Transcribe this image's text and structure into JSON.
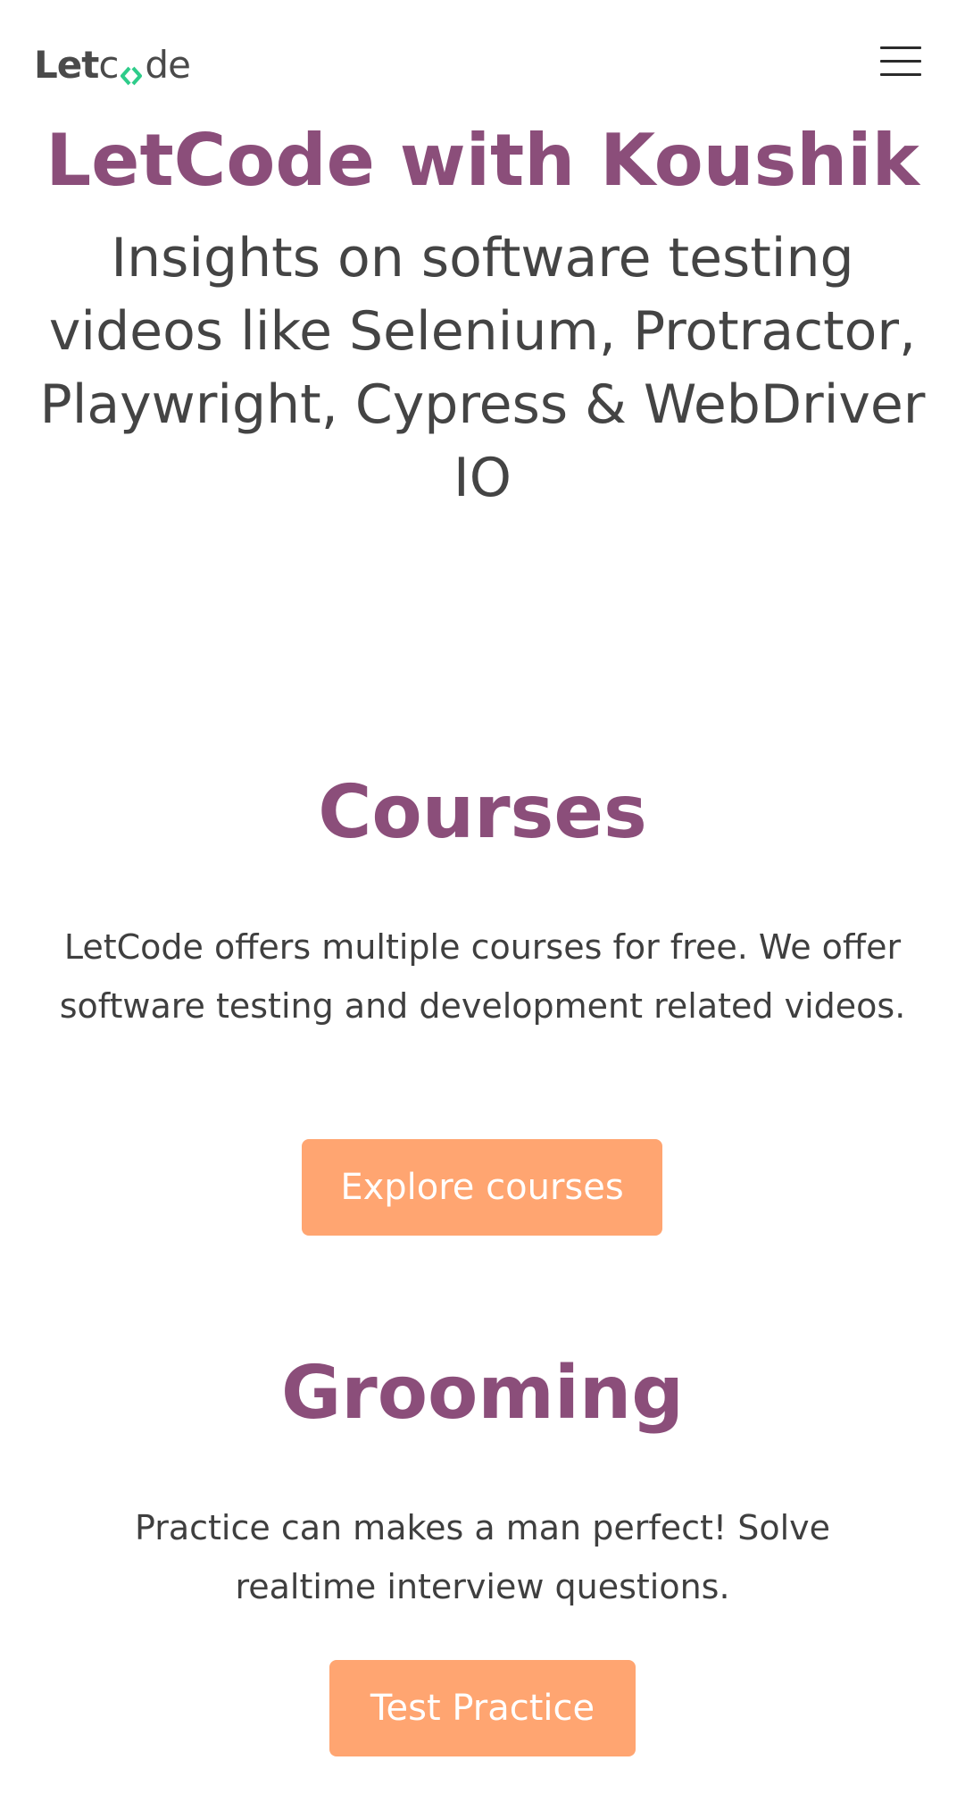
{
  "navbar": {
    "logo": {
      "part1": "Let",
      "part2a": "c",
      "part2b": "de"
    },
    "menu_icon": "hamburger-menu-icon",
    "accent_green": "#2ecc8a"
  },
  "hero": {
    "title": "LetCode with Koushik",
    "subtitle": "Insights on software testing videos like Selenium, Protractor, Playwright, Cypress & WebDriver IO"
  },
  "courses": {
    "heading": "Courses",
    "description": "LetCode offers multiple courses for free. We offer software testing and development related videos.",
    "button_label": "Explore courses"
  },
  "grooming": {
    "heading": "Grooming",
    "description": "Practice can makes a man perfect! Solve realtime interview questions.",
    "button_label": "Test Practice"
  },
  "colors": {
    "heading": "#8b4e7a",
    "button": "#ffa571",
    "text": "#3f3f3f"
  }
}
